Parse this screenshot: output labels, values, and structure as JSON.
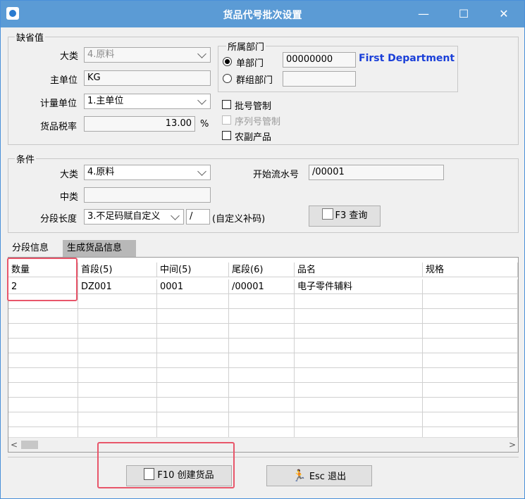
{
  "window": {
    "title": "货品代号批次设置",
    "minimize": "—",
    "maximize": "☐",
    "close": "✕"
  },
  "defaults": {
    "legend": "缺省值",
    "category_label": "大类",
    "category_value": "4.原料",
    "main_unit_label": "主单位",
    "main_unit_value": "KG",
    "measure_unit_label": "计量单位",
    "measure_unit_value": "1.主单位",
    "tax_label": "货品税率",
    "tax_value": "13.00",
    "tax_unit": "%",
    "dept": {
      "legend": "所属部门",
      "single_label": "单部门",
      "single_code": "00000000",
      "single_name": "First Department",
      "group_label": "群组部门",
      "group_value": ""
    },
    "batch_label": "批号管制",
    "serial_label": "序列号管制",
    "agri_label": "农副产品"
  },
  "conditions": {
    "legend": "条件",
    "category_label": "大类",
    "category_value": "4.原料",
    "mid_label": "中类",
    "mid_value": "",
    "seg_label": "分段长度",
    "seg_value": "3.不足码赋自定义",
    "sep_value": "/",
    "custom_label": "(自定义补码)",
    "start_label": "开始流水号",
    "start_value": "/00001",
    "query_button": "F3 查询"
  },
  "tabs": [
    "分段信息",
    "生成货品信息"
  ],
  "grid": {
    "headers": [
      "数量",
      "首段(5)",
      "中间(5)",
      "尾段(6)",
      "品名",
      "规格"
    ],
    "rows": [
      [
        "2",
        "DZ001",
        "0001",
        "/00001",
        "电子零件辅料",
        ""
      ]
    ]
  },
  "buttons": {
    "create": "F10 创建货品",
    "exit": "Esc 退出"
  },
  "colors": {
    "titlebar": "#5b9bd5",
    "highlight": "#e8566a",
    "dept_name": "#1a3fd8"
  }
}
